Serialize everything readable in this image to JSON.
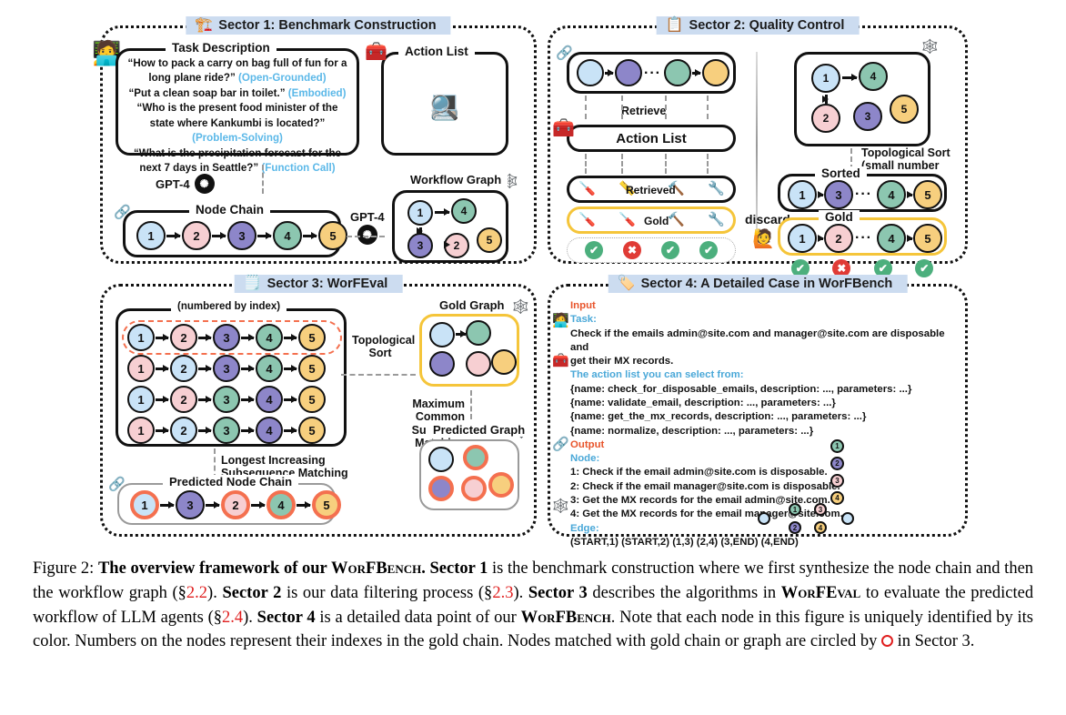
{
  "figure": {
    "sectors": [
      {
        "id": "s1",
        "icon": "🏗",
        "title": "Sector 1: Benchmark Construction"
      },
      {
        "id": "s2",
        "icon": "📋",
        "title": "Sector 2: Quality Control"
      },
      {
        "id": "s3",
        "icon": "🗒",
        "title": "Sector 3: WorFEval"
      },
      {
        "id": "s4",
        "icon": "🔖",
        "title": "Sector 4: A Detailed Case in WorFBench"
      }
    ]
  },
  "sector1": {
    "task_box_label": "Task Description",
    "tasks": [
      {
        "text": "“How to pack a carry on bag full of fun for a long plane ride?”",
        "tag": "(Open-Grounded)"
      },
      {
        "text": "“Put a clean soap bar in toilet.”",
        "tag": "(Embodied)"
      },
      {
        "text": "“Who is the present food minister of the state where Kankumbi is located?”",
        "tag": "(Problem-Solving)"
      },
      {
        "text": "“What is the precipitation forecast for the next 7 days in Seattle?”",
        "tag": "(Function Call)"
      }
    ],
    "action_list_label": "Action List",
    "action_icons": [
      "api-cloud-icon",
      "robot-arm-icon",
      "code-monitor-icon",
      "calculator-search-icon"
    ],
    "gpt_label": "GPT-4",
    "node_chain_label": "Node Chain",
    "node_chain": [
      {
        "index": "1",
        "color": "c1"
      },
      {
        "index": "2",
        "color": "c2"
      },
      {
        "index": "3",
        "color": "c3"
      },
      {
        "index": "4",
        "color": "c4"
      },
      {
        "index": "5",
        "color": "c5"
      }
    ],
    "workflow_graph_label": "Workflow Graph",
    "workflow_nodes": [
      {
        "index": "1",
        "color": "c1"
      },
      {
        "index": "4",
        "color": "c4"
      },
      {
        "index": "5",
        "color": "c5"
      },
      {
        "index": "3",
        "color": "c3"
      },
      {
        "index": "2",
        "color": "c2"
      }
    ]
  },
  "sector2": {
    "retrieve_label": "Retrieve",
    "action_list_label": "Action List",
    "retrieved_label": "Retrieved",
    "gold_label": "Gold",
    "discard_label": "discard",
    "chain_nodes": [
      {
        "color": "c1"
      },
      {
        "color": "c3"
      },
      {
        "color": "c4"
      },
      {
        "color": "c5"
      }
    ],
    "retrieved_tools": [
      "🪛",
      "📏",
      "🔨",
      "🔧"
    ],
    "gold_tools": [
      "🪛",
      "🪛",
      "🔨",
      "🔧"
    ],
    "left_marks": [
      "ok",
      "bad",
      "ok",
      "ok"
    ],
    "right_marks": [
      "ok",
      "bad",
      "ok",
      "ok"
    ],
    "graph_nodes": [
      {
        "index": "1",
        "color": "c1"
      },
      {
        "index": "4",
        "color": "c4"
      },
      {
        "index": "5",
        "color": "c5"
      },
      {
        "index": "2",
        "color": "c2"
      },
      {
        "index": "3",
        "color": "c3"
      }
    ],
    "topo_sort_label": "Topological Sort",
    "topo_sort_sub": "(small number first)",
    "sorted_label": "Sorted",
    "sorted_chain": [
      {
        "index": "1",
        "color": "c1"
      },
      {
        "index": "3",
        "color": "c3"
      },
      {
        "index": "4",
        "color": "c4"
      },
      {
        "index": "5",
        "color": "c5"
      }
    ],
    "gold_chain_label": "Gold",
    "gold_chain": [
      {
        "index": "1",
        "color": "c1"
      },
      {
        "index": "2",
        "color": "c2"
      },
      {
        "index": "4",
        "color": "c4"
      },
      {
        "index": "5",
        "color": "c5"
      }
    ]
  },
  "sector3": {
    "numbered_label": "(numbered by index)",
    "chains": [
      [
        {
          "index": "1",
          "color": "c1"
        },
        {
          "index": "2",
          "color": "c2"
        },
        {
          "index": "3",
          "color": "c3"
        },
        {
          "index": "4",
          "color": "c4"
        },
        {
          "index": "5",
          "color": "c5"
        }
      ],
      [
        {
          "index": "1",
          "color": "c2"
        },
        {
          "index": "2",
          "color": "c1"
        },
        {
          "index": "3",
          "color": "c3"
        },
        {
          "index": "4",
          "color": "c4"
        },
        {
          "index": "5",
          "color": "c5"
        }
      ],
      [
        {
          "index": "1",
          "color": "c1"
        },
        {
          "index": "2",
          "color": "c2"
        },
        {
          "index": "3",
          "color": "c4"
        },
        {
          "index": "4",
          "color": "c3"
        },
        {
          "index": "5",
          "color": "c5"
        }
      ],
      [
        {
          "index": "1",
          "color": "c2"
        },
        {
          "index": "2",
          "color": "c1"
        },
        {
          "index": "3",
          "color": "c4"
        },
        {
          "index": "4",
          "color": "c3"
        },
        {
          "index": "5",
          "color": "c5"
        }
      ]
    ],
    "topo_sort_label": "Topological",
    "topo_sort_label2": "Sort",
    "gold_graph_label": "Gold Graph",
    "gold_graph_nodes": [
      {
        "color": "c1"
      },
      {
        "color": "c4"
      },
      {
        "color": "c5"
      },
      {
        "color": "c3"
      },
      {
        "color": "c2"
      }
    ],
    "mcs_label": "Maximum Common",
    "mcs_label2": "Subgraph Matching",
    "predicted_graph_label": "Predicted Graph",
    "predicted_graph_nodes": [
      {
        "color": "c1",
        "match": false
      },
      {
        "color": "c4",
        "match": true
      },
      {
        "color": "c5",
        "match": true
      },
      {
        "color": "c3",
        "match": true
      },
      {
        "color": "c2",
        "match": true
      }
    ],
    "lis_label": "Longest Increasing",
    "lis_label2": "Subsequence Matching",
    "predicted_chain_label": "Predicted Node Chain",
    "predicted_chain": [
      {
        "index": "1",
        "color": "c1",
        "match": true
      },
      {
        "index": "3",
        "color": "c3",
        "match": false
      },
      {
        "index": "2",
        "color": "c2",
        "match": true
      },
      {
        "index": "4",
        "color": "c4",
        "match": true
      },
      {
        "index": "5",
        "color": "c5",
        "match": true
      }
    ]
  },
  "sector4": {
    "input_label": "Input",
    "task_label": "Task:",
    "task_text_l1": "Check if the emails admin@site.com and manager@site.com are disposable and",
    "task_text_l2": "get their MX records.",
    "action_list_label": "The action list you can select from:",
    "actions": [
      "{name: check_for_disposable_emails, description: ..., parameters: ...}",
      "{name: validate_email, description: ..., parameters: ...}",
      "{name: get_the_mx_records, description: ..., parameters: ...}",
      "{name: normalize, description: ..., parameters: ...}"
    ],
    "output_label": "Output",
    "node_label": "Node:",
    "nodes": [
      "1: Check if the email admin@site.com is disposable.",
      "2: Check if the email manager@site.com is disposable.",
      "3: Get the MX records for the email admin@site.com.",
      "4: Get the MX records for the email manager@site.com."
    ],
    "node_colors": [
      "c4",
      "c3",
      "c2",
      "c5"
    ],
    "edge_label": "Edge:",
    "edges_text": "(START,1) (START,2) (1,3) (2,4) (3,END) (4,END)"
  },
  "caption": {
    "prefix": "Figure 2:",
    "b1": "The overview framework of our",
    "sc1": "WorFBench",
    "b1b": ".",
    "b2": "Sector 1",
    "t2": "is the benchmark construction where we first synthesize the node chain and then the workflow graph (§",
    "r1": "2.2",
    "t2b": ").",
    "b3": "Sector 2",
    "t3": "is our data filtering process (§",
    "r2": "2.3",
    "t3b": ").",
    "b4": "Sector 3",
    "t4": "describes the algorithms in",
    "sc2": "WorFEval",
    "t4b": "to evaluate the predicted workflow of LLM agents (§",
    "r3": "2.4",
    "t4c": ").",
    "b5": "Sector 4",
    "t5": "is a detailed data point of our",
    "sc3": "WorFBench",
    "t5b": ". Note that each node in this figure is uniquely identified by its color. Numbers on the nodes represent their indexes in the gold chain. Nodes matched with gold chain or graph are circled by",
    "t5c": "in Sector 3."
  }
}
